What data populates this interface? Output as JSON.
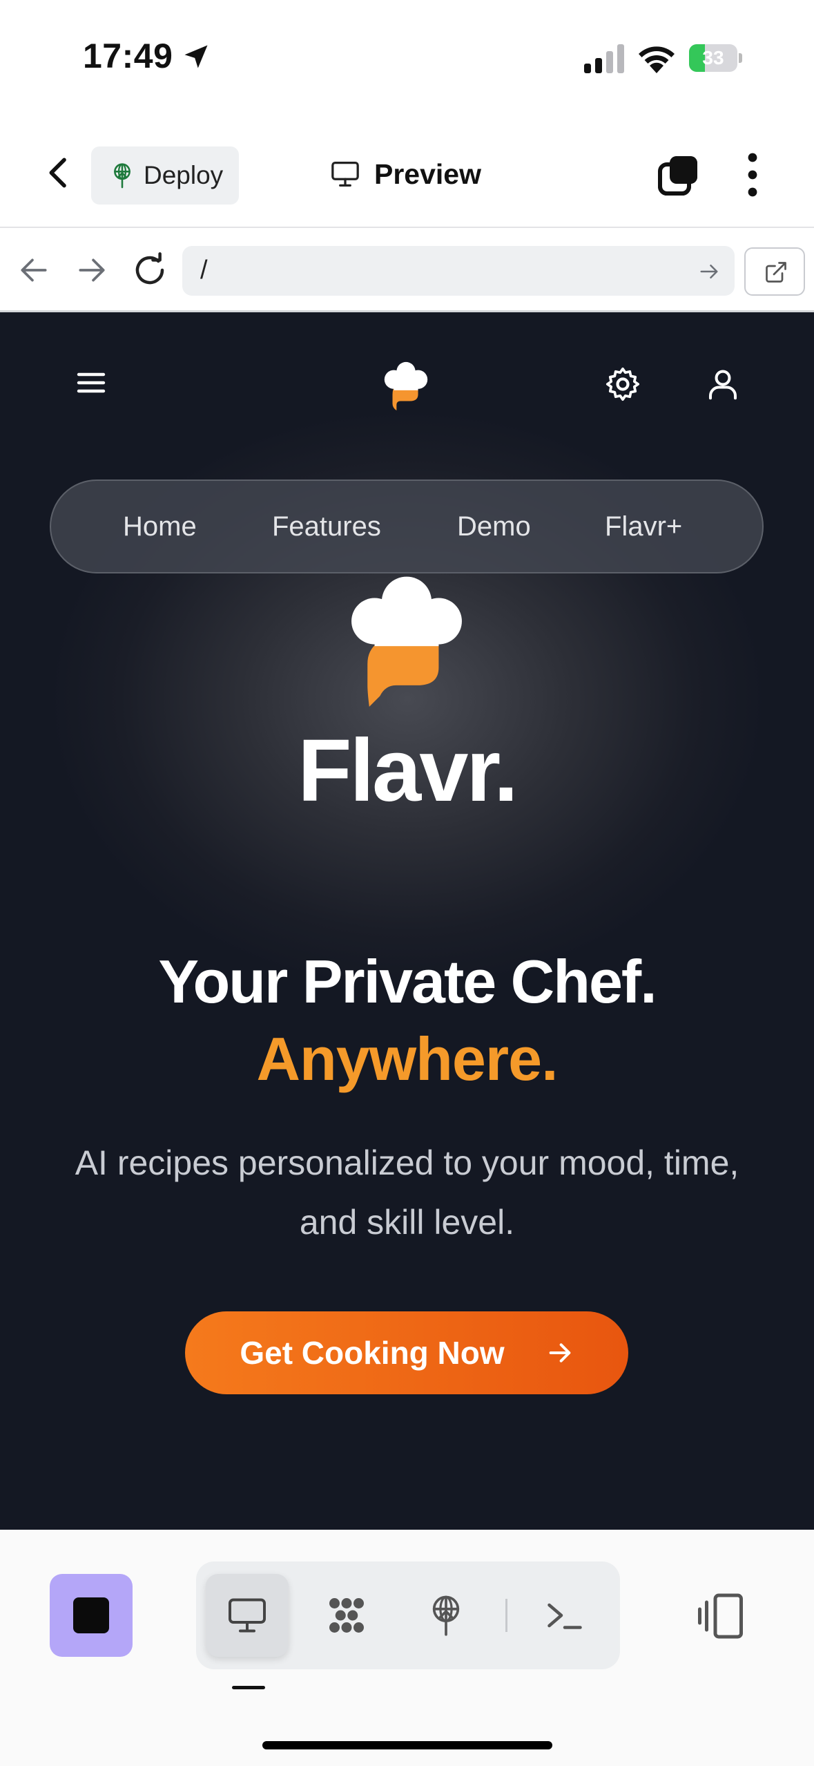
{
  "status_bar": {
    "time": "17:49",
    "battery_text": "33",
    "battery_level": 0.33,
    "icons": [
      "location-arrow-icon",
      "cellular-signal-icon",
      "wifi-icon",
      "battery-charging-icon"
    ]
  },
  "app_header": {
    "deploy_label": "Deploy",
    "preview_label": "Preview",
    "icons": [
      "back-chevron-icon",
      "deploy-globe-icon",
      "monitor-icon",
      "tabs-icon",
      "more-vertical-icon"
    ]
  },
  "url_bar": {
    "value": "/",
    "icons": [
      "arrow-left-icon",
      "arrow-right-icon",
      "reload-icon",
      "go-arrow-icon",
      "open-external-icon"
    ]
  },
  "site": {
    "nav_items": [
      "Home",
      "Features",
      "Demo",
      "Flavr+"
    ],
    "brand": "Flavr.",
    "headline_line1": "Your Private Chef.",
    "headline_line2": "Anywhere.",
    "subtitle": "AI recipes personalized to your mood, time, and skill level.",
    "cta_label": "Get Cooking Now",
    "colors": {
      "accent_orange": "#f59a2a",
      "cta_start": "#f57a1c",
      "cta_end": "#e8560f",
      "background": "#141823"
    },
    "icons": [
      "menu-icon",
      "chef-hat-logo-icon",
      "settings-gear-icon",
      "user-icon",
      "arrow-right-icon"
    ]
  },
  "toolbar": {
    "tools": [
      "monitor-preview-icon",
      "workflow-dots-icon",
      "deploy-globe-icon",
      "terminal-icon"
    ],
    "active_tool": "monitor-preview-icon",
    "accent": "#b4a6f8",
    "icons": [
      "stop-icon",
      "device-layout-icon"
    ]
  }
}
